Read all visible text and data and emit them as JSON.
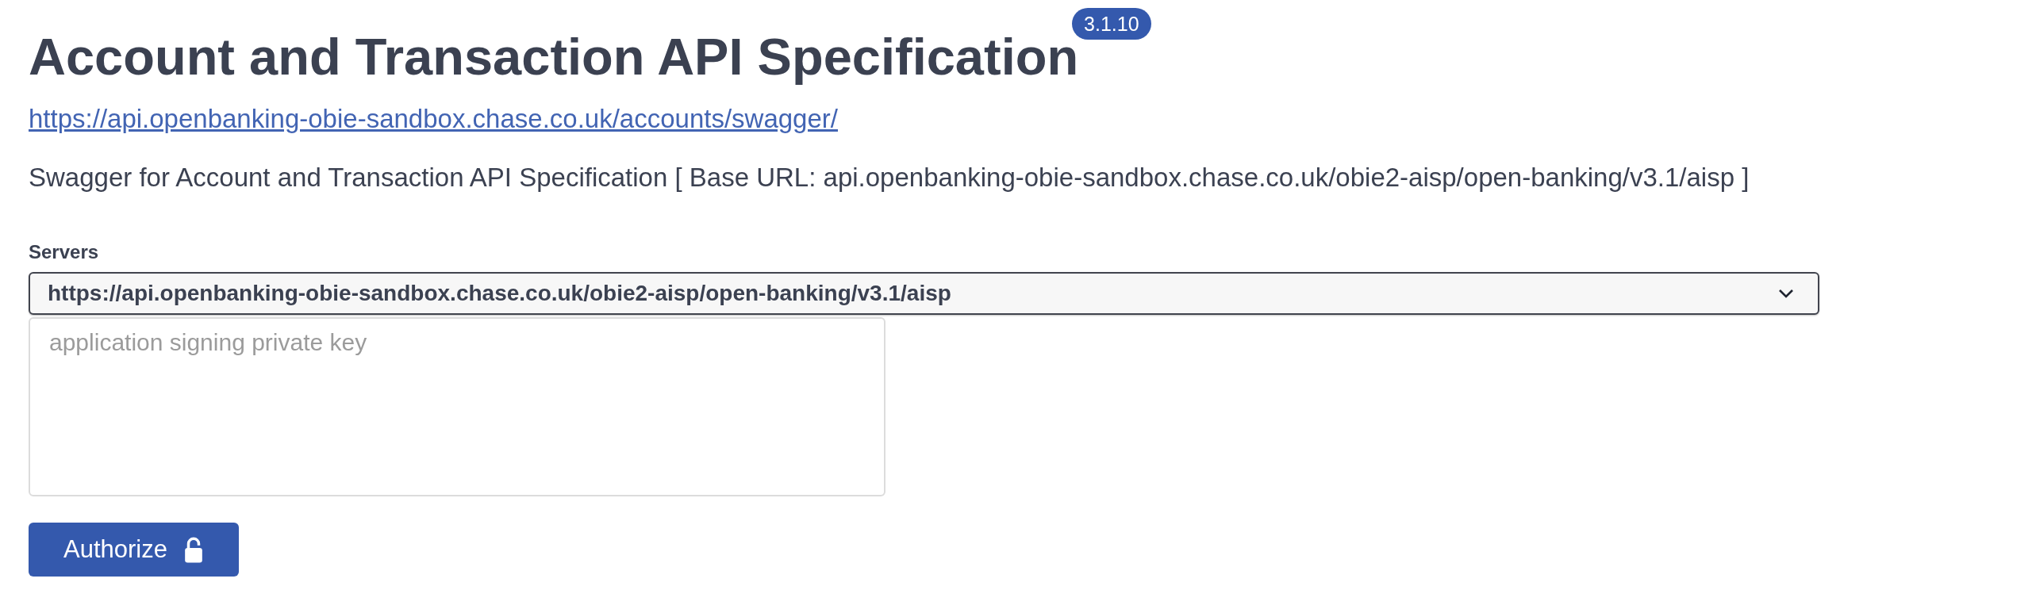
{
  "header": {
    "title": "Account and Transaction API Specification",
    "version_badge": "3.1.10",
    "link": "https://api.openbanking-obie-sandbox.chase.co.uk/accounts/swagger/",
    "description": "Swagger for Account and Transaction API Specification [ Base URL: api.openbanking-obie-sandbox.chase.co.uk/obie2-aisp/open-banking/v3.1/aisp ]"
  },
  "servers": {
    "label": "Servers",
    "selected_value": "https://api.openbanking-obie-sandbox.chase.co.uk/obie2-aisp/open-banking/v3.1/aisp"
  },
  "signing_key": {
    "placeholder": "application signing private key"
  },
  "authorize_button": {
    "label": "Authorize",
    "locked": false
  }
}
